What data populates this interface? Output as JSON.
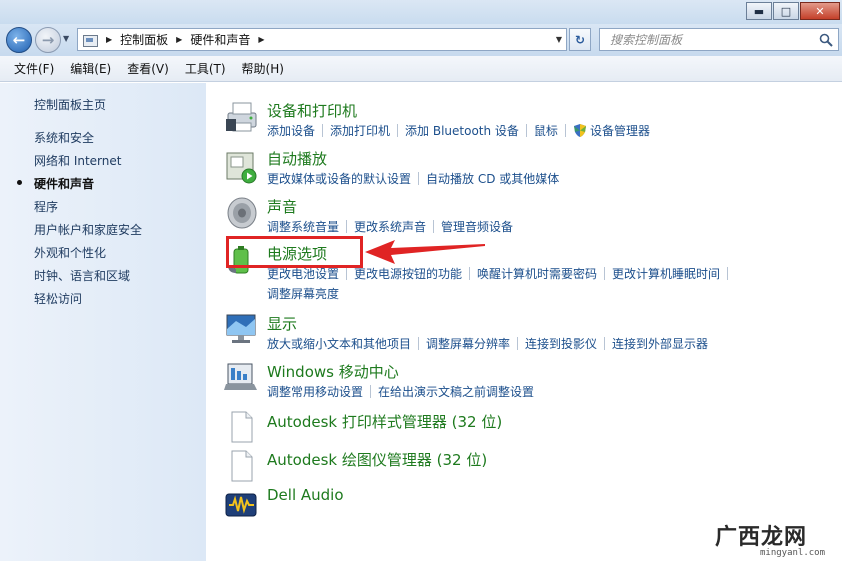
{
  "titlebar": {
    "minimize": "▬",
    "maximize": "□",
    "close": "✕"
  },
  "address": {
    "crumbs": [
      "控制面板",
      "硬件和声音"
    ],
    "search_placeholder": "搜索控制面板"
  },
  "menu": [
    "文件(F)",
    "编辑(E)",
    "查看(V)",
    "工具(T)",
    "帮助(H)"
  ],
  "sidebar": {
    "items": [
      {
        "label": "控制面板主页"
      },
      {
        "label": "系统和安全"
      },
      {
        "label": "网络和 Internet"
      },
      {
        "label": "硬件和声音",
        "current": true
      },
      {
        "label": "程序"
      },
      {
        "label": "用户帐户和家庭安全"
      },
      {
        "label": "外观和个性化"
      },
      {
        "label": "时钟、语言和区域"
      },
      {
        "label": "轻松访问"
      }
    ]
  },
  "categories": [
    {
      "title": "设备和打印机",
      "icon": "printer-icon",
      "links": [
        "添加设备",
        "添加打印机",
        "添加 Bluetooth 设备",
        "鼠标",
        "设备管理器"
      ]
    },
    {
      "title": "自动播放",
      "icon": "autoplay-icon",
      "links": [
        "更改媒体或设备的默认设置",
        "自动播放 CD 或其他媒体"
      ]
    },
    {
      "title": "声音",
      "icon": "speaker-icon",
      "links": [
        "调整系统音量",
        "更改系统声音",
        "管理音频设备"
      ]
    },
    {
      "title": "电源选项",
      "icon": "power-icon",
      "links": [
        "更改电池设置",
        "更改电源按钮的功能",
        "唤醒计算机时需要密码",
        "更改计算机睡眠时间"
      ],
      "links2": [
        "调整屏幕亮度"
      ]
    },
    {
      "title": "显示",
      "icon": "display-icon",
      "links": [
        "放大或缩小文本和其他项目",
        "调整屏幕分辨率",
        "连接到投影仪",
        "连接到外部显示器"
      ]
    },
    {
      "title": "Windows 移动中心",
      "icon": "mobility-center-icon",
      "links": [
        "调整常用移动设置",
        "在给出演示文稿之前调整设置"
      ]
    },
    {
      "title": "Autodesk 打印样式管理器 (32 位)",
      "icon": "document-icon",
      "links": []
    },
    {
      "title": "Autodesk 绘图仪管理器 (32 位)",
      "icon": "document-icon",
      "links": []
    },
    {
      "title": "Dell Audio",
      "icon": "dell-audio-icon",
      "links": []
    }
  ],
  "watermark": {
    "text": "广西龙网",
    "url": "mingyanl.com"
  },
  "colors": {
    "highlight": "#e02424",
    "link": "#1c4f8c",
    "title": "#1e7a1e"
  }
}
